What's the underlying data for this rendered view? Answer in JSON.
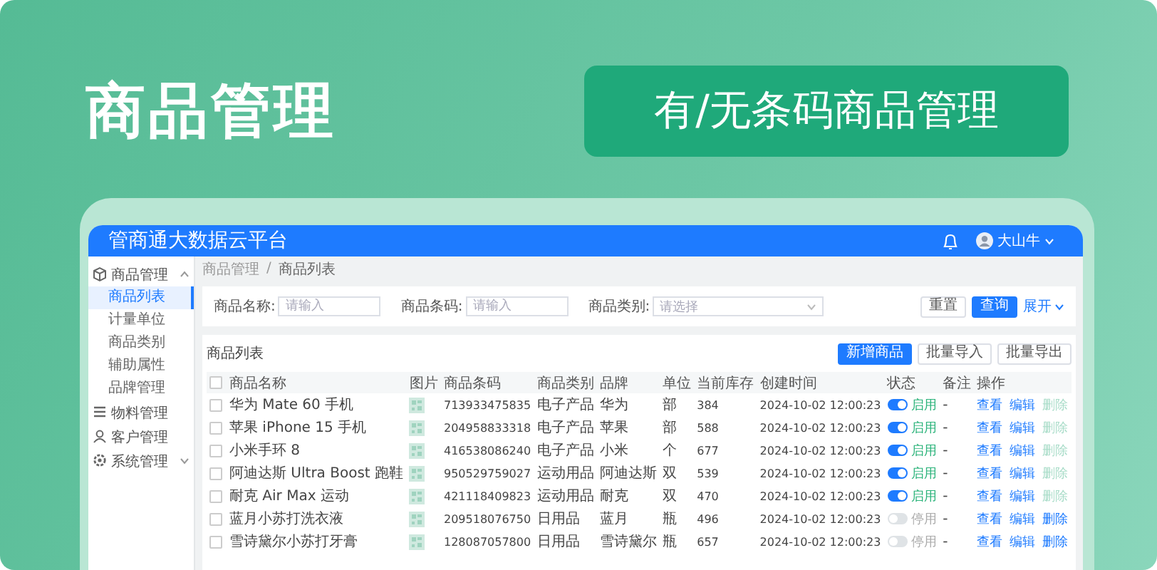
{
  "banner": {
    "title": "商品管理",
    "feature_button": "有/无条码商品管理"
  },
  "app": {
    "title": "管商通大数据云平台",
    "user": "大山牛",
    "sidebar": [
      {
        "label": "商品管理",
        "expanded": true,
        "children": [
          {
            "label": "商品列表",
            "selected": true
          },
          {
            "label": "计量单位",
            "selected": false
          },
          {
            "label": "商品类别",
            "selected": false
          },
          {
            "label": "辅助属性",
            "selected": false
          },
          {
            "label": "品牌管理",
            "selected": false
          }
        ]
      },
      {
        "label": "物料管理"
      },
      {
        "label": "客户管理"
      },
      {
        "label": "系统管理",
        "expanded": false
      }
    ],
    "breadcrumb": {
      "items": [
        "商品管理",
        "商品列表"
      ],
      "separator": "/"
    },
    "filters": [
      {
        "label": "商品名称:",
        "placeholder": "请输入",
        "kind": "input"
      },
      {
        "label": "商品条码:",
        "placeholder": "请输入",
        "kind": "input"
      },
      {
        "label": "商品类别:",
        "placeholder": "请选择",
        "kind": "select"
      }
    ],
    "filter_buttons": {
      "reset": "重置",
      "search": "查询",
      "expand": "展开"
    },
    "list": {
      "title": "商品列表",
      "buttons": [
        {
          "label": "新增商品",
          "primary": true
        },
        {
          "label": "批量导入",
          "primary": false
        },
        {
          "label": "批量导出",
          "primary": false
        }
      ],
      "select_all_checked": false,
      "columns": [
        "商品名称",
        "图片",
        "商品条码",
        "商品类别",
        "品牌",
        "单位",
        "当前库存",
        "创建时间",
        "状态",
        "备注",
        "操作"
      ],
      "rows": [
        {
          "checked": false,
          "name": "华为 Mate 60 手机",
          "code": "713933475835",
          "category": "电子产品",
          "brand": "华为",
          "unit": "部",
          "stock": "384",
          "created": "2024-10-02 12:00:23",
          "on": true,
          "status": "启用",
          "note": "-",
          "actions": [
            {
              "label": "查看",
              "disabled": false
            },
            {
              "label": "编辑",
              "disabled": false
            },
            {
              "label": "删除",
              "disabled": true
            }
          ]
        },
        {
          "checked": false,
          "name": "苹果 iPhone 15 手机",
          "code": "204958833318",
          "category": "电子产品",
          "brand": "苹果",
          "unit": "部",
          "stock": "588",
          "created": "2024-10-02 12:00:23",
          "on": true,
          "status": "启用",
          "note": "-",
          "actions": [
            {
              "label": "查看",
              "disabled": false
            },
            {
              "label": "编辑",
              "disabled": false
            },
            {
              "label": "删除",
              "disabled": true
            }
          ]
        },
        {
          "checked": false,
          "name": "小米手环 8",
          "code": "416538086240",
          "category": "电子产品",
          "brand": "小米",
          "unit": "个",
          "stock": "677",
          "created": "2024-10-02 12:00:23",
          "on": true,
          "status": "启用",
          "note": "-",
          "actions": [
            {
              "label": "查看",
              "disabled": false
            },
            {
              "label": "编辑",
              "disabled": false
            },
            {
              "label": "删除",
              "disabled": true
            }
          ]
        },
        {
          "checked": false,
          "name": "阿迪达斯 Ultra Boost 跑鞋",
          "code": "950529759027",
          "category": "运动用品",
          "brand": "阿迪达斯",
          "unit": "双",
          "stock": "539",
          "created": "2024-10-02 12:00:23",
          "on": true,
          "status": "启用",
          "note": "-",
          "actions": [
            {
              "label": "查看",
              "disabled": false
            },
            {
              "label": "编辑",
              "disabled": false
            },
            {
              "label": "删除",
              "disabled": true
            }
          ]
        },
        {
          "checked": false,
          "name": "耐克 Air Max 运动",
          "code": "421118409823",
          "category": "运动用品",
          "brand": "耐克",
          "unit": "双",
          "stock": "470",
          "created": "2024-10-02 12:00:23",
          "on": true,
          "status": "启用",
          "note": "-",
          "actions": [
            {
              "label": "查看",
              "disabled": false
            },
            {
              "label": "编辑",
              "disabled": false
            },
            {
              "label": "删除",
              "disabled": true
            }
          ]
        },
        {
          "checked": false,
          "name": "蓝月小苏打洗衣液",
          "code": "209518076750",
          "category": "日用品",
          "brand": "蓝月",
          "unit": "瓶",
          "stock": "496",
          "created": "2024-10-02 12:00:23",
          "on": false,
          "status": "停用",
          "note": "-",
          "actions": [
            {
              "label": "查看",
              "disabled": false
            },
            {
              "label": "编辑",
              "disabled": false
            },
            {
              "label": "删除",
              "disabled": false
            }
          ]
        },
        {
          "checked": false,
          "name": "雪诗黛尔小苏打牙膏",
          "code": "128087057800",
          "category": "日用品",
          "brand": "雪诗黛尔",
          "unit": "瓶",
          "stock": "657",
          "created": "2024-10-02 12:00:23",
          "on": false,
          "status": "停用",
          "note": "-",
          "actions": [
            {
              "label": "查看",
              "disabled": false
            },
            {
              "label": "编辑",
              "disabled": false
            },
            {
              "label": "删除",
              "disabled": false
            }
          ]
        }
      ]
    }
  }
}
